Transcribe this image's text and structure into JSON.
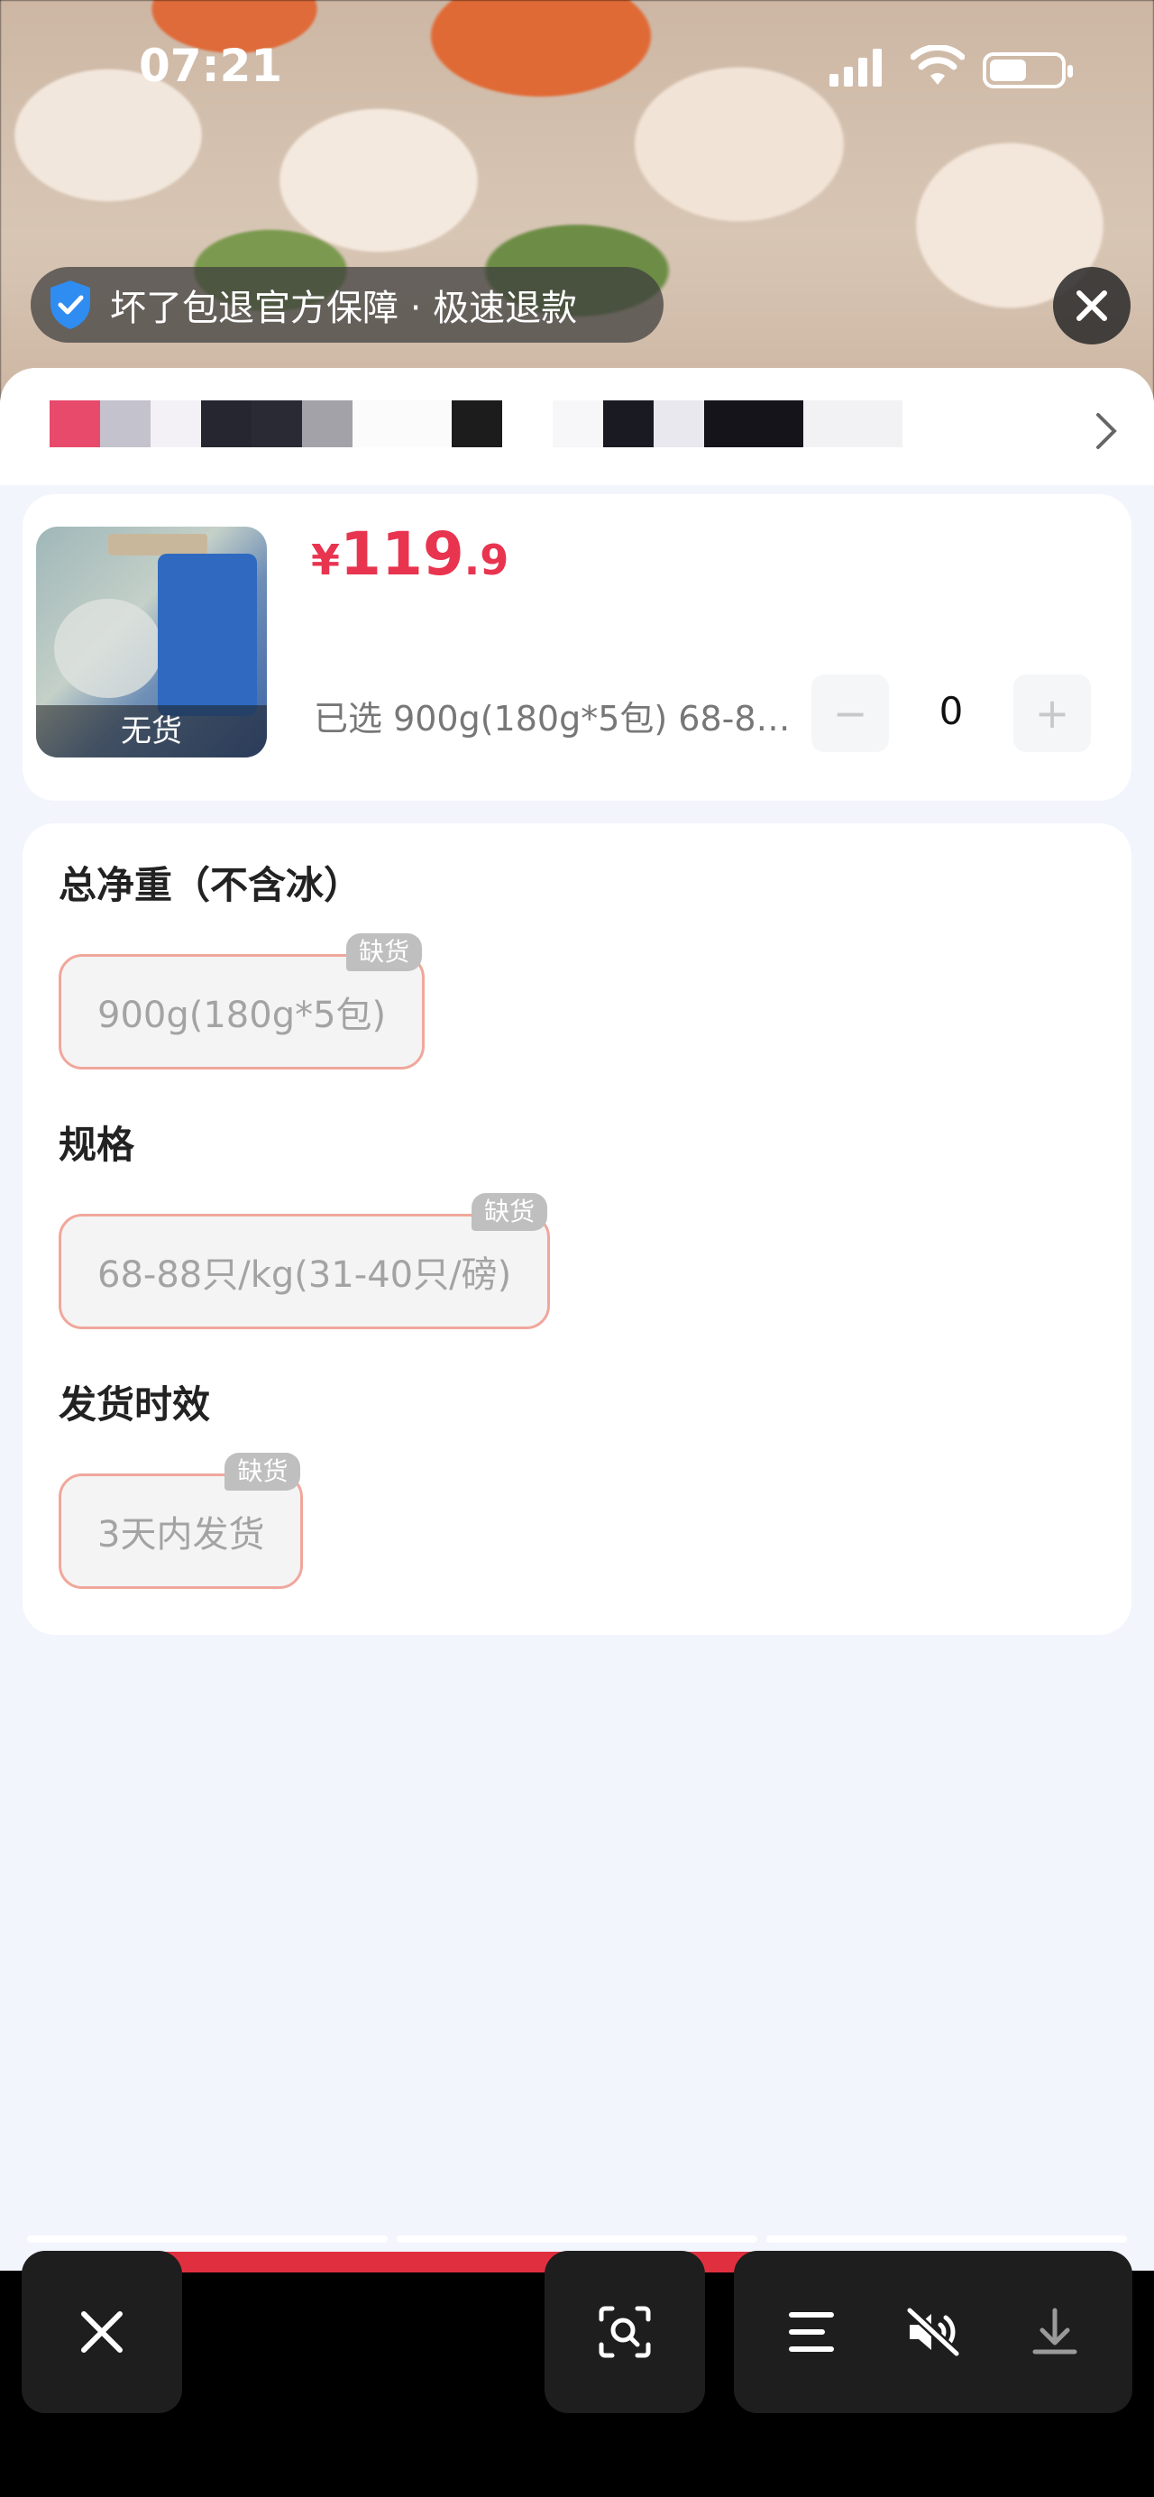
{
  "status_bar": {
    "time": "07:21"
  },
  "guarantee_banner": {
    "text": "坏了包退官方保障 · 极速退款"
  },
  "product": {
    "price_symbol": "¥",
    "price_integer": "119",
    "price_decimal": ".9",
    "thumbnail_label": "无货",
    "selected_text": "已选 900g(180g*5包) 68-88…",
    "quantity": "0",
    "minus_label": "−",
    "plus_label": "+"
  },
  "spec_groups": [
    {
      "title": "总净重（不含冰）",
      "option": "900g(180g*5包)",
      "tag": "缺货"
    },
    {
      "title": "规格",
      "option": "68-88只/kg(31-40只/磅)",
      "tag": "缺货"
    },
    {
      "title": "发货时效",
      "option": "3天内发货",
      "tag": "缺货"
    }
  ],
  "colors": {
    "price": "#e8344f",
    "chip_border": "#f0a79b",
    "sheet_bg": "#f3f5fd",
    "action_red": "#e0303f"
  },
  "toolbar_icons": [
    "close-icon",
    "scan-search-icon",
    "menu-icon",
    "mute-icon",
    "download-icon"
  ]
}
